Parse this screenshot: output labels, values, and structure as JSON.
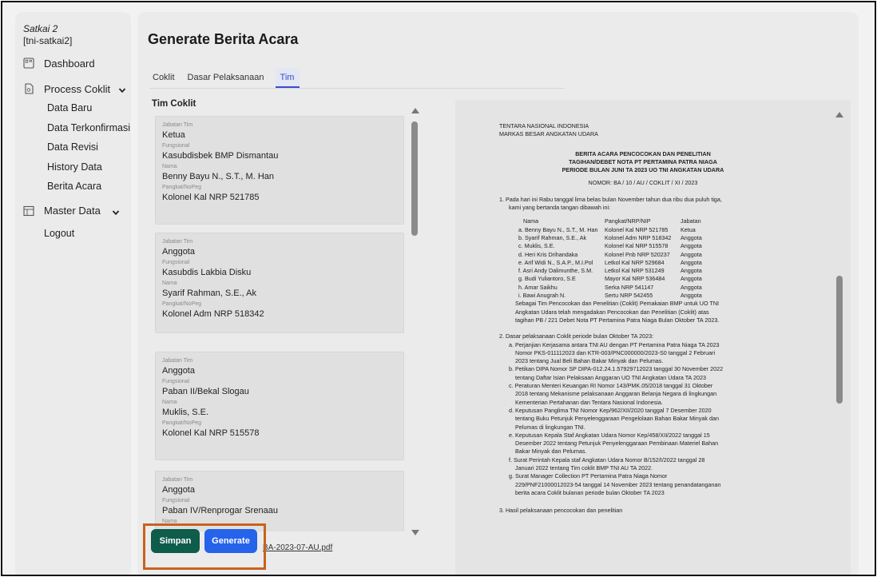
{
  "sidebar": {
    "org_name": "Satkai 2",
    "org_id": "[tni-satkai2]",
    "items": {
      "dashboard": "Dashboard",
      "process_coklit": "Process Coklit",
      "sub": [
        "Data Baru",
        "Data Terkonfirmasi",
        "Data Revisi",
        "History Data",
        "Berita Acara"
      ],
      "master_data": "Master Data",
      "logout": "Logout"
    }
  },
  "page": {
    "title": "Generate Berita Acara",
    "tabs": [
      "Coklit",
      "Dasar Pelaksanaan",
      "Tim"
    ],
    "active_tab": "Tim",
    "team_title": "Tim Coklit"
  },
  "field_labels": {
    "jabatan": "Jabatan Tim",
    "fungsional": "Fungsional",
    "nama": "Nama",
    "pangkat": "Pangkat/NoPeg"
  },
  "team": [
    {
      "jabatan": "Ketua",
      "fungsional": "Kasubdisbek BMP Dismantau",
      "nama": "Benny Bayu N., S.T., M. Han",
      "pangkat": "Kolonel Kal NRP 521785"
    },
    {
      "jabatan": "Anggota",
      "fungsional": "Kasubdis Lakbia Disku",
      "nama": "Syarif Rahman, S.E., Ak",
      "pangkat": "Kolonel Adm NRP 518342"
    },
    {
      "jabatan": "Anggota",
      "fungsional": "Paban II/Bekal Slogau",
      "nama": "Muklis, S.E.",
      "pangkat": "Kolonel Kal NRP 515578"
    },
    {
      "jabatan": "Anggota",
      "fungsional": "Paban IV/Renprogar Srenaau",
      "nama": "",
      "pangkat": ""
    }
  ],
  "buttons": {
    "save": "Simpan",
    "generate": "Generate",
    "file": "BA-2023-07-AU.pdf"
  },
  "document": {
    "header1": "TENTARA NASIONAL INDONESIA",
    "header2": "MARKAS BESAR ANGKATAN UDARA",
    "title1": "BERITA ACARA PENCOCOKAN DAN PENELITIAN",
    "title2": "TAGIHAN/DEBET NOTA PT PERTAMINA PATRA NIAGA",
    "title3": "PERIODE BULAN JUNI TA 2023 UO TNI ANGKATAN UDARA",
    "nomor": "NOMOR: BA / 10 / AU / COKLIT / XI / 2023",
    "p1_line1": "1. Pada hari ini Rabu tanggal lima belas bulan November tahun dua ribu dua puluh tiga,",
    "p1_line2": "kami yang bertanda tangan dibawah ini:",
    "members_header": [
      "Nama",
      "Pangkat/NRP/NIP",
      "Jabatan"
    ],
    "members": [
      [
        "a. Benny Bayu N., S.T., M. Han",
        "Kolonel Kal NRP 521785",
        "Ketua"
      ],
      [
        "b. Syarif Rahman, S.E., Ak",
        "Kolonel Adm NRP 518342",
        "Anggota"
      ],
      [
        "c. Muklis, S.E.",
        "Kolonel Kal NRP 515578",
        "Anggota"
      ],
      [
        "d. Heri Kris Drihandaka",
        "Kolonel Pnb NRP 520237",
        "Anggota"
      ],
      [
        "e. Arif Widi N., S.A.P., M.I.Pol",
        "Letkol Kal NRP 529684",
        "Anggota"
      ],
      [
        "f. Asri Andy Dalimunthe, S.M.",
        "Letkol Kal NRP 531249",
        "Anggota"
      ],
      [
        "g. Budi Yuliantoro, S.E",
        "Mayor Kal NRP 536484",
        "Anggota"
      ],
      [
        "h. Amar Saikhu",
        "Serka NRP 541147",
        "Anggota"
      ],
      [
        "i. Bawi Anugrah N.",
        "Sertu NRP 542455",
        "Anggota"
      ]
    ],
    "p1_closing": [
      "Sebagai Tim Pencocokan dan Penelitian (Coklit) Pemakaian BMP untuk UO TNI",
      "Angkatan Udara telah mengadakan Pencocokan dan Penelitian (Coklit) atas",
      "tagihan PB / 221 Debet Nota PT Pertamina Patra Niaga Bulan Oktober TA 2023."
    ],
    "p2_title": "2. Dasar pelaksanaan Coklit periode bulan Oktober TA 2023:",
    "p2_items": [
      "a. Perjanjian Kerjasama antara TNI AU dengan PT Pertamina Patra Niaga TA 2023",
      "Nomor PKS-011112023 dan KTR-003/PNC000000/2023-S0 tanggal 2 Februari",
      "2023 tentang Jual Beli Bahan Bakar Minyak dan Pelumas.",
      "b. Petikan DIPA Nomor SP DIPA-012.24.1.57929712023 tanggal 30 November 2022",
      "tentang Daftar Isian Pelaksaan Anggaran UO TNI Angkatan Udara TA 2023",
      "c. Peraturan Menteri Keuangan RI Nomor 143/PMK.05/2018 tanggal 31 Oktober",
      "2018 tentang Mekanisme pelaksanaan Anggaran Belanja Negara di lingkungan",
      "Kementerian Pertahanan dan Tentara Nasional Indonesia.",
      "d. Keputusan Panglima TNI Nomor Kep/962/XII/2020 tanggal 7 Desember 2020",
      "tentang Buku Petunjuk Penyelenggaraan Pengelolaan Bahan Bakar Minyak dan",
      "Pelumas di lingkungan TNI.",
      "e. Keputusan Kepala Staf Angkatan Udara Nomor Kep/458/XII/2022 tanggal 15",
      "Desember 2022 tentang Petunjuk Penyelenggaraan Pembinaan Materiel Bahan",
      "Bakar Minyak dan Pelumas.",
      "f. Surat Perintah Kepala staf Angkatan Udara Nomor B/152/I/2022 tanggal 28",
      "Januari 2022 tentang Tim coklit BMP TNI AU TA 2022.",
      "g. Surat Manager Collection PT Pertamina Patra Niaga Nomor",
      "229/PNF21000012023-54 tanggal 14 November 2023 tentang penandatanganan",
      "berita acara Coklit bulanan periode bulan Oktober TA 2023"
    ],
    "p3_title": "3. Hasil pelaksanaan pencocokan dan penelitian"
  }
}
